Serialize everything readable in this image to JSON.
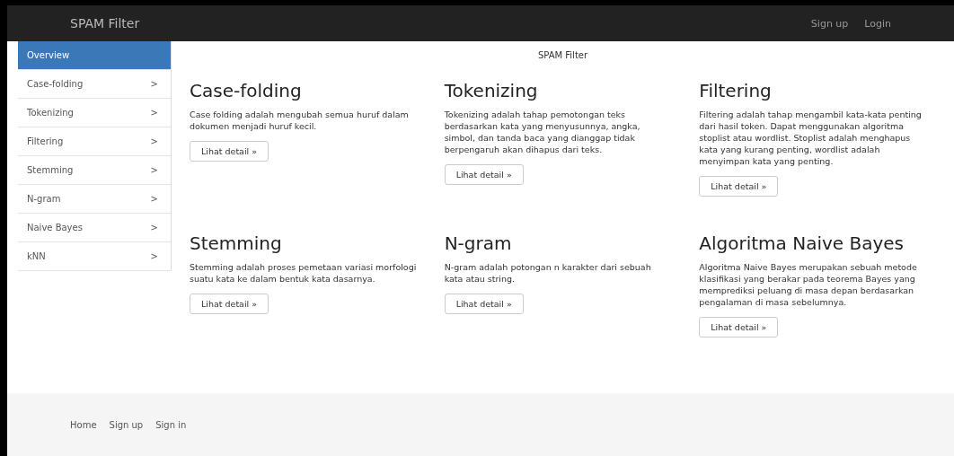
{
  "navbar": {
    "brand": "SPAM Filter",
    "links": [
      "Sign up",
      "Login"
    ]
  },
  "sidebar": {
    "items": [
      {
        "label": "Overview",
        "selected": true
      },
      {
        "label": "Case-folding",
        "selected": false,
        "chevron": ">"
      },
      {
        "label": "Tokenizing",
        "selected": false,
        "chevron": ">"
      },
      {
        "label": "Filtering",
        "selected": false,
        "chevron": ">"
      },
      {
        "label": "Stemming",
        "selected": false,
        "chevron": ">"
      },
      {
        "label": "N-gram",
        "selected": false,
        "chevron": ">"
      },
      {
        "label": "Naive Bayes",
        "selected": false,
        "chevron": ">"
      },
      {
        "label": "kNN",
        "selected": false,
        "chevron": ">"
      }
    ]
  },
  "page_title": "SPAM Filter",
  "cards": [
    {
      "title": "Case-folding",
      "text": "Case folding adalah mengubah semua huruf dalam dokumen menjadi huruf kecil.",
      "button": "Lihat detail »"
    },
    {
      "title": "Tokenizing",
      "text": "Tokenizing adalah tahap pemotongan teks berdasarkan kata yang menyusunnya, angka, simbol, dan tanda baca yang dianggap tidak berpengaruh akan dihapus dari teks.",
      "button": "Lihat detail »"
    },
    {
      "title": "Filtering",
      "text": "Filtering adalah tahap mengambil kata-kata penting dari hasil token. Dapat menggunakan algoritma stoplist atau wordlist. Stoplist adalah menghapus kata yang kurang penting, wordlist adalah menyimpan kata yang penting.",
      "button": "Lihat detail »"
    },
    {
      "title": "Stemming",
      "text": "Stemming adalah proses pemetaan variasi morfologi suatu kata ke dalam bentuk kata dasarnya.",
      "button": "Lihat detail »"
    },
    {
      "title": "N-gram",
      "text": "N-gram adalah potongan n karakter dari sebuah kata atau string.",
      "button": "Lihat detail »"
    },
    {
      "title": "Algoritma Naive Bayes",
      "text": "Algoritma Naive Bayes merupakan sebuah metode klasifikasi yang berakar pada teorema Bayes yang memprediksi peluang di masa depan berdasarkan pengalaman di masa sebelumnya.",
      "button": "Lihat detail »"
    }
  ],
  "footer": {
    "links": [
      "Home",
      "Sign up",
      "Sign in"
    ]
  }
}
